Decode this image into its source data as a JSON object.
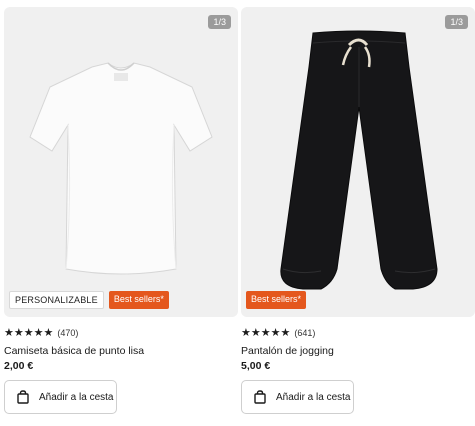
{
  "products": [
    {
      "image_counter": "1/3",
      "image_subject": "white-tshirt",
      "badges": [
        "PERSONALIZABLE",
        "Best sellers*"
      ],
      "rating_stars": 5,
      "rating_count": "(470)",
      "title": "Camiseta básica de punto lisa",
      "price": "2,00 €",
      "cart_label": "Añadir a la cesta"
    },
    {
      "image_counter": "1/3",
      "image_subject": "black-jogging-pants",
      "badges": [
        "Best sellers*"
      ],
      "rating_stars": 5,
      "rating_count": "(641)",
      "title": "Pantalón de jogging",
      "price": "5,00 €",
      "cart_label": "Añadir a la cesta"
    }
  ],
  "colors": {
    "badge_orange": "#e4571d",
    "image_bg": "#f0f0f0",
    "counter_bg": "#9b9b9b"
  },
  "icons": [
    "star-icon",
    "shopping-bag-icon"
  ]
}
